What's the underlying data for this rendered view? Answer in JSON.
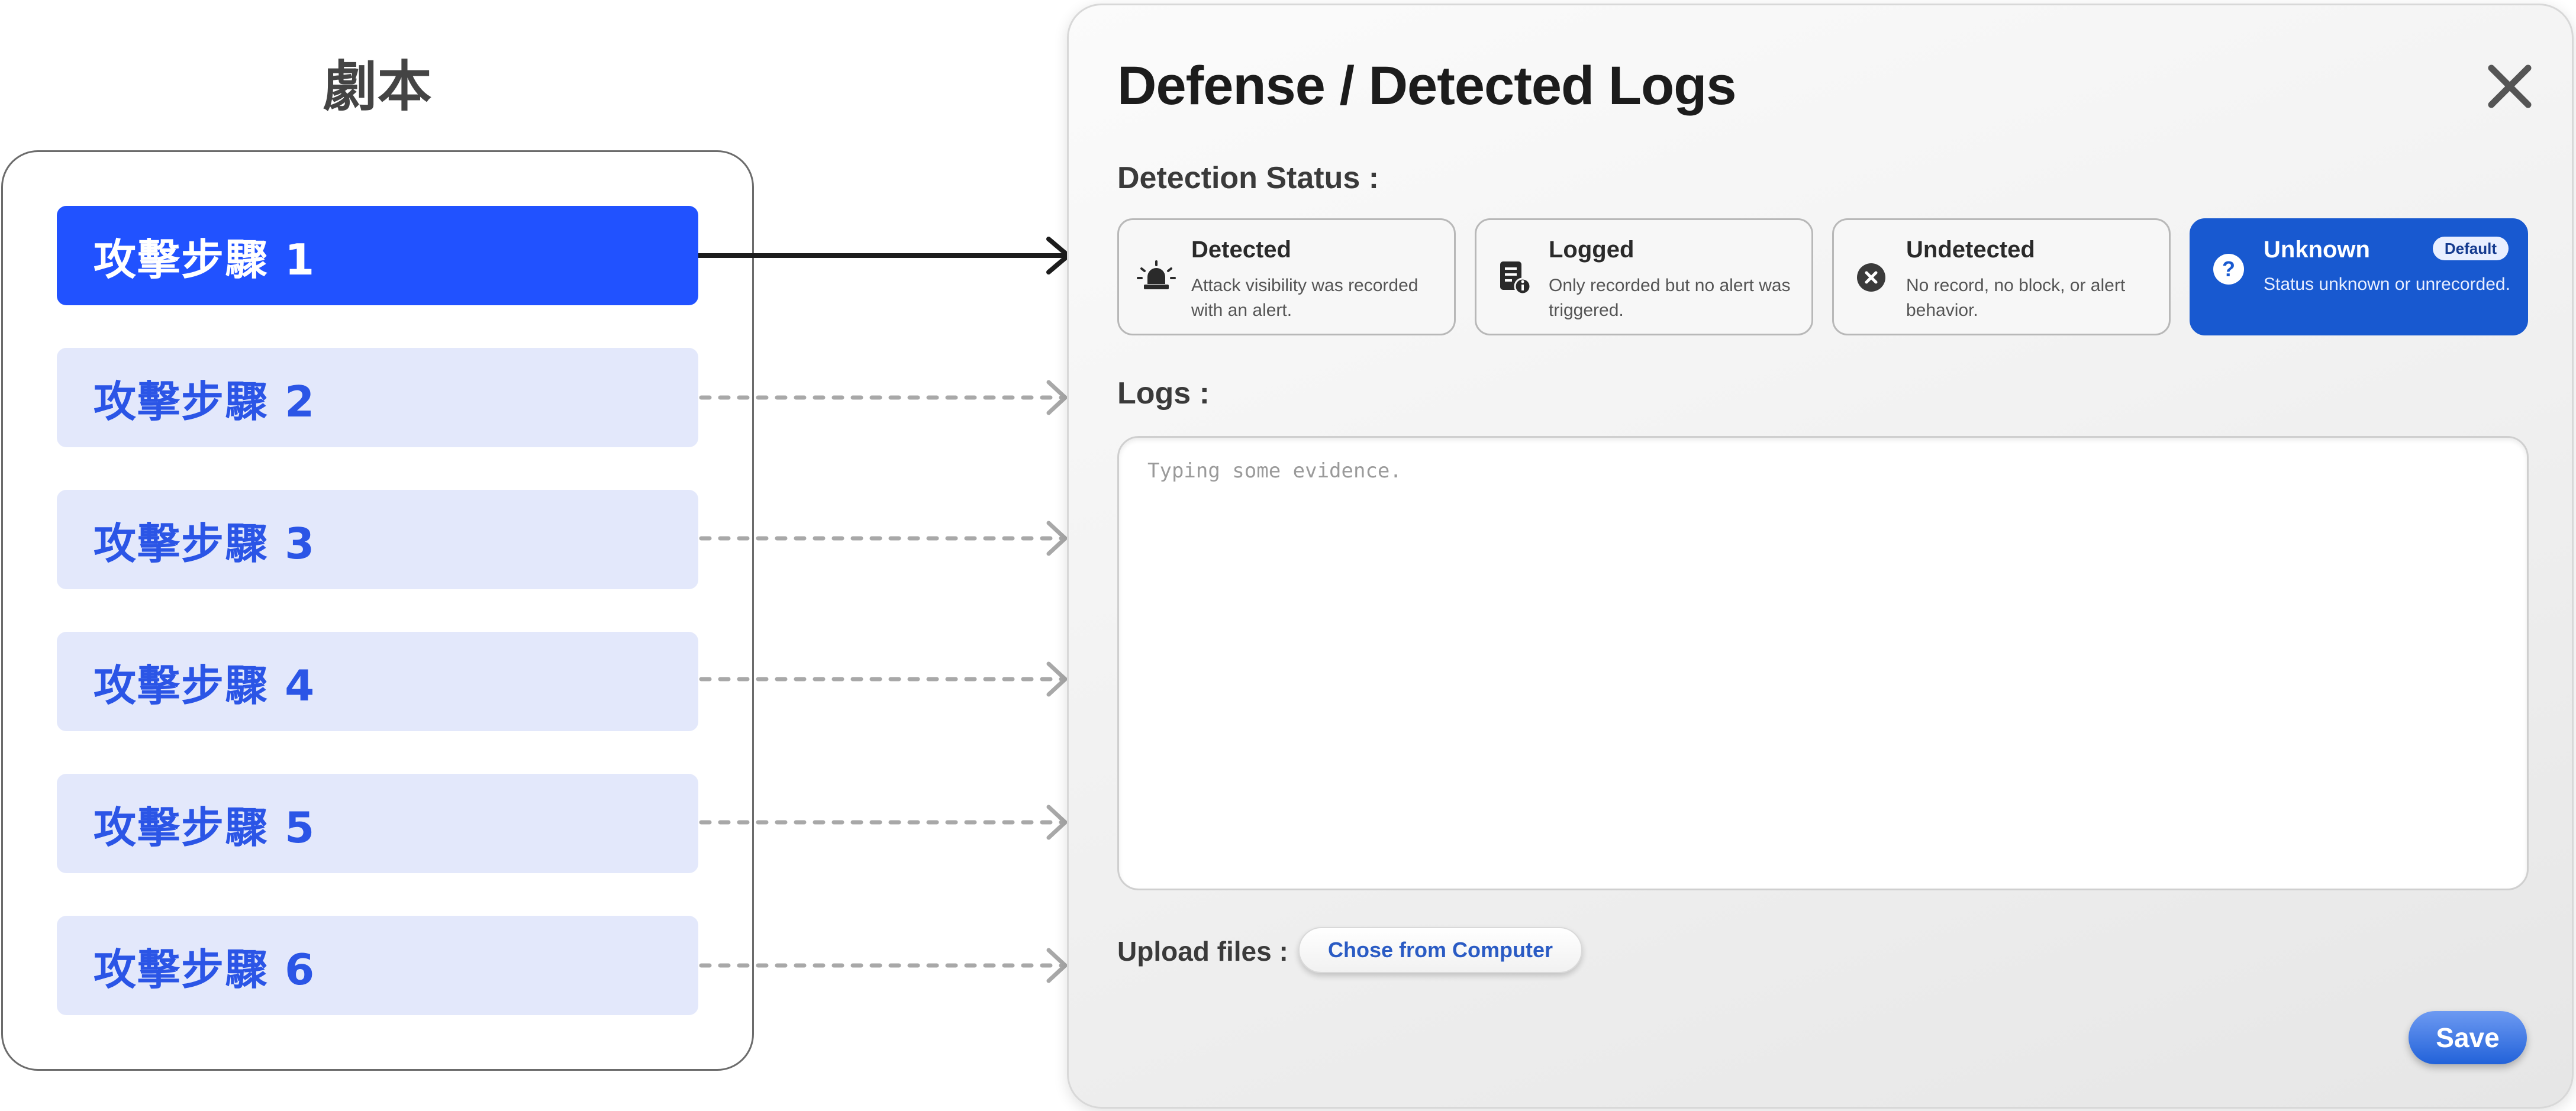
{
  "script": {
    "title": "劇本",
    "steps": [
      {
        "label": "攻擊步驟 1",
        "active": true
      },
      {
        "label": "攻擊步驟 2",
        "active": false
      },
      {
        "label": "攻擊步驟 3",
        "active": false
      },
      {
        "label": "攻擊步驟 4",
        "active": false
      },
      {
        "label": "攻擊步驟 5",
        "active": false
      },
      {
        "label": "攻擊步驟 6",
        "active": false
      }
    ]
  },
  "modal": {
    "title": "Defense / Detected Logs",
    "close_icon": "close-icon",
    "detection_status_label": "Detection Status :",
    "statuses": [
      {
        "name": "Detected",
        "description": "Attack visibility was recorded with an alert.",
        "icon": "siren-icon",
        "selected": false
      },
      {
        "name": "Logged",
        "description": "Only recorded but no alert was triggered.",
        "icon": "log-info-icon",
        "selected": false
      },
      {
        "name": "Undetected",
        "description": "No record, no block, or alert behavior.",
        "icon": "x-circle-icon",
        "selected": false
      },
      {
        "name": "Unknown",
        "description": "Status unknown or unrecorded.",
        "icon": "question-circle-icon",
        "selected": true,
        "badge": "Default"
      }
    ],
    "logs_label": "Logs :",
    "logs_placeholder": "Typing some evidence.",
    "logs_value": "",
    "upload_label": "Upload files :",
    "upload_button": "Chose from Computer",
    "save_button": "Save"
  },
  "colors": {
    "accent": "#2152ff",
    "selected_status": "#1859d0",
    "step_inactive_bg": "#e3e8fb",
    "step_inactive_text": "#2b55e6"
  }
}
